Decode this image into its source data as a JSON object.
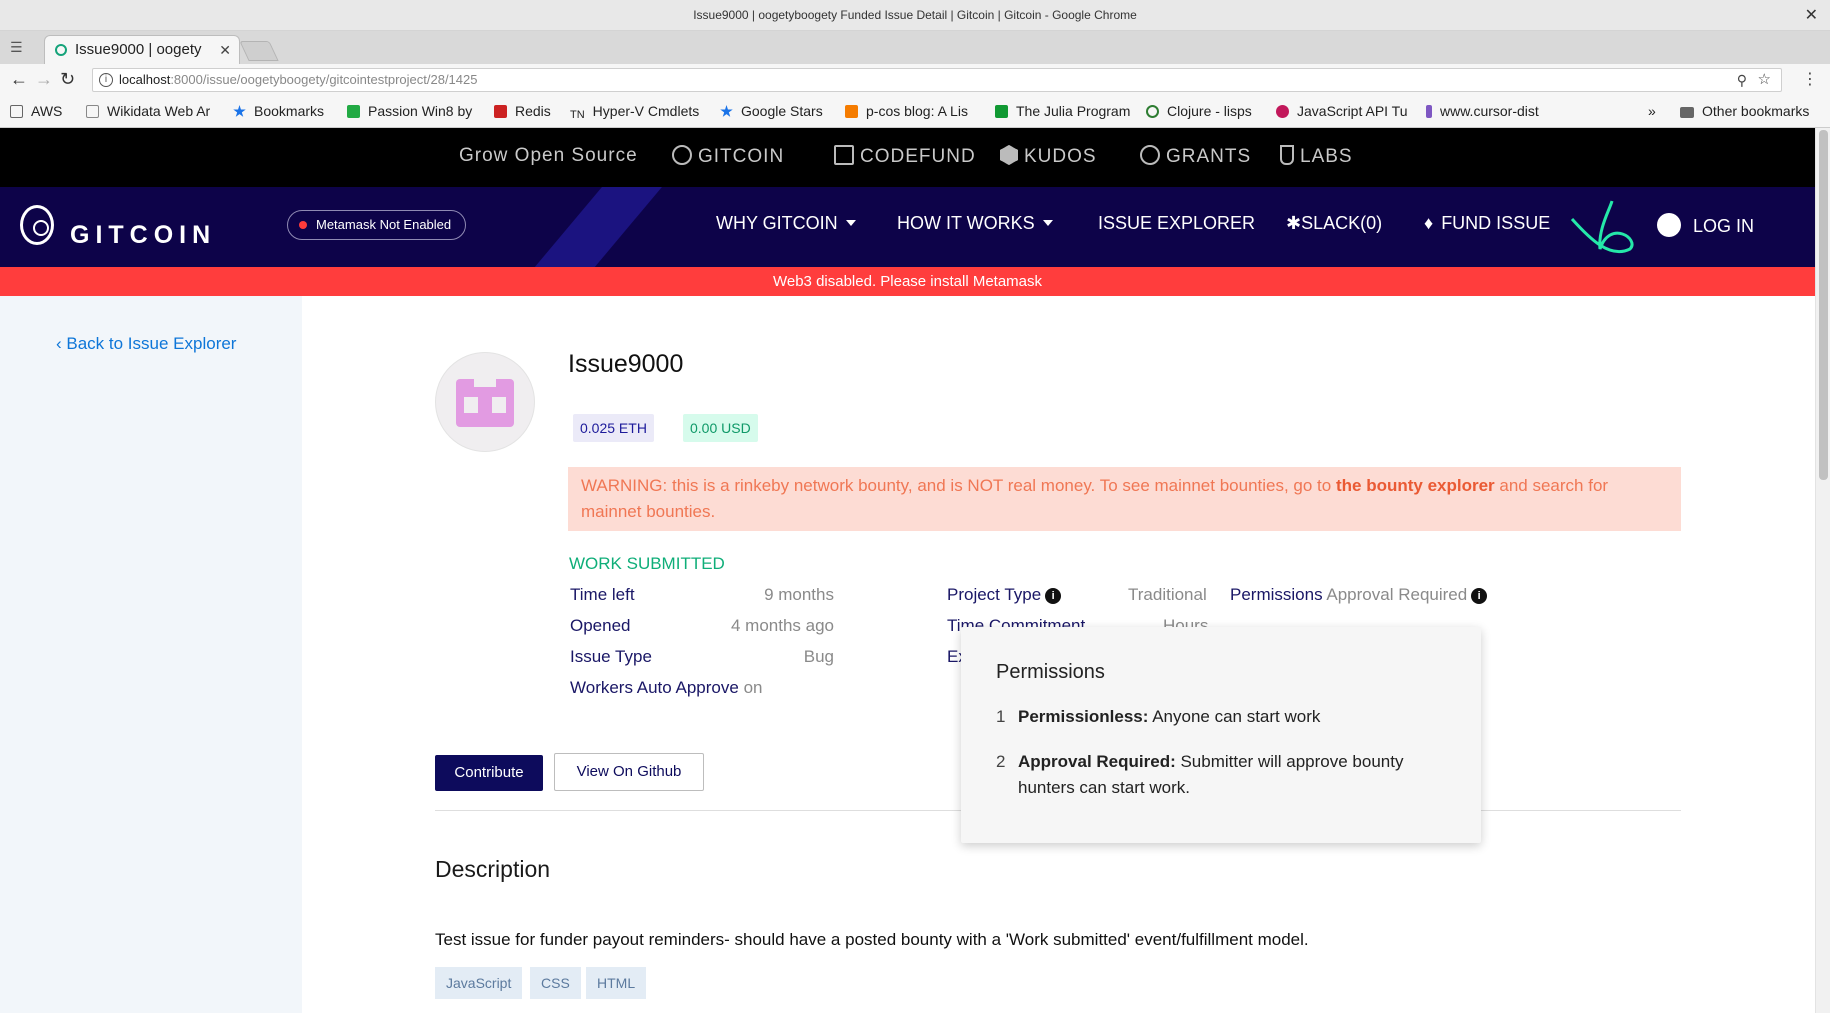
{
  "window": {
    "title": "Issue9000 | oogetyboogety Funded Issue Detail | Gitcoin | Gitcoin - Google Chrome",
    "close": "✕"
  },
  "tab": {
    "title": "Issue9000 | oogety",
    "close": "✕"
  },
  "address": {
    "host": "localhost",
    "path": ":8000/issue/oogetyboogety/gitcointestproject/28/1425"
  },
  "bookmarks": [
    {
      "label": "AWS",
      "color": "#666666"
    },
    {
      "label": "Wikidata Web Ar",
      "color": "#888888"
    },
    {
      "label": "Bookmarks",
      "color": "#1a73e8"
    },
    {
      "label": "Passion Win8 by",
      "color": "#22aa44"
    },
    {
      "label": "Redis",
      "color": "#cc2222"
    },
    {
      "label": "Hyper-V Cmdlets",
      "color": "#333333"
    },
    {
      "label": "Google Stars",
      "color": "#1a73e8"
    },
    {
      "label": "p-cos blog: A Lis",
      "color": "#f57c00"
    },
    {
      "label": "The Julia Program",
      "color": "#119933"
    },
    {
      "label": "Clojure - lisps",
      "color": "#2e7d32"
    },
    {
      "label": "JavaScript API Tu",
      "color": "#c2185b"
    },
    {
      "label": "www.cursor-dist",
      "color": "#7e57c2"
    }
  ],
  "bookmarks_overflow": "»",
  "other_bookmarks": "Other bookmarks",
  "topnav": {
    "grow": "Grow Open Source",
    "gitcoin": "GITCOIN",
    "codefund": "CODEFUND",
    "kudos": "KUDOS",
    "grants": "GRANTS",
    "labs": "LABS"
  },
  "mainnav": {
    "logo": "GITCOIN",
    "metamask": "Metamask Not Enabled",
    "why": "WHY GITCOIN",
    "how": "HOW IT WORKS",
    "explorer": "ISSUE EXPLORER",
    "slack": "SLACK(0)",
    "fund": "FUND ISSUE",
    "login": "LOG IN"
  },
  "banner": "Web3 disabled. Please install Metamask",
  "back_link": "Back to Issue Explorer",
  "issue": {
    "title": "Issue9000",
    "eth": "0.025 ETH",
    "usd": "0.00 USD",
    "warning_pre": "WARNING: this is a rinkeby network bounty, and is NOT real money. To see mainnet bounties, go to ",
    "warning_link": "the bounty explorer",
    "warning_post": " and search for mainnet bounties.",
    "status": "WORK SUBMITTED"
  },
  "details": {
    "time_left_label": "Time left",
    "time_left": "9 months",
    "opened_label": "Opened",
    "opened": "4 months ago",
    "issue_type_label": "Issue Type",
    "issue_type": "Bug",
    "auto_approve_label": "Workers Auto Approve",
    "auto_approve": "on",
    "project_type_label": "Project Type",
    "project_type": "Traditional",
    "time_commitment_label": "Time Commitment",
    "time_commitment": "Hours",
    "experience_label": "Ex",
    "permissions_label": "Permissions",
    "permissions": "Approval Required"
  },
  "popover": {
    "title": "Permissions",
    "items": [
      {
        "num": "1",
        "bold": "Permissionless:",
        "text": " Anyone can start work"
      },
      {
        "num": "2",
        "bold": "Approval Required:",
        "text": " Submitter will approve bounty hunters can start work."
      }
    ]
  },
  "buttons": {
    "contribute": "Contribute",
    "github": "View On Github"
  },
  "description": {
    "heading": "Description",
    "text": "Test issue for funder payout reminders- should have a posted bounty with a 'Work submitted' event/fulfillment model."
  },
  "tags": [
    "JavaScript",
    "CSS",
    "HTML"
  ],
  "colors": {
    "nav_bg": "#0d0349",
    "accent": "#25e8a9",
    "banner": "#ff3d3d"
  }
}
